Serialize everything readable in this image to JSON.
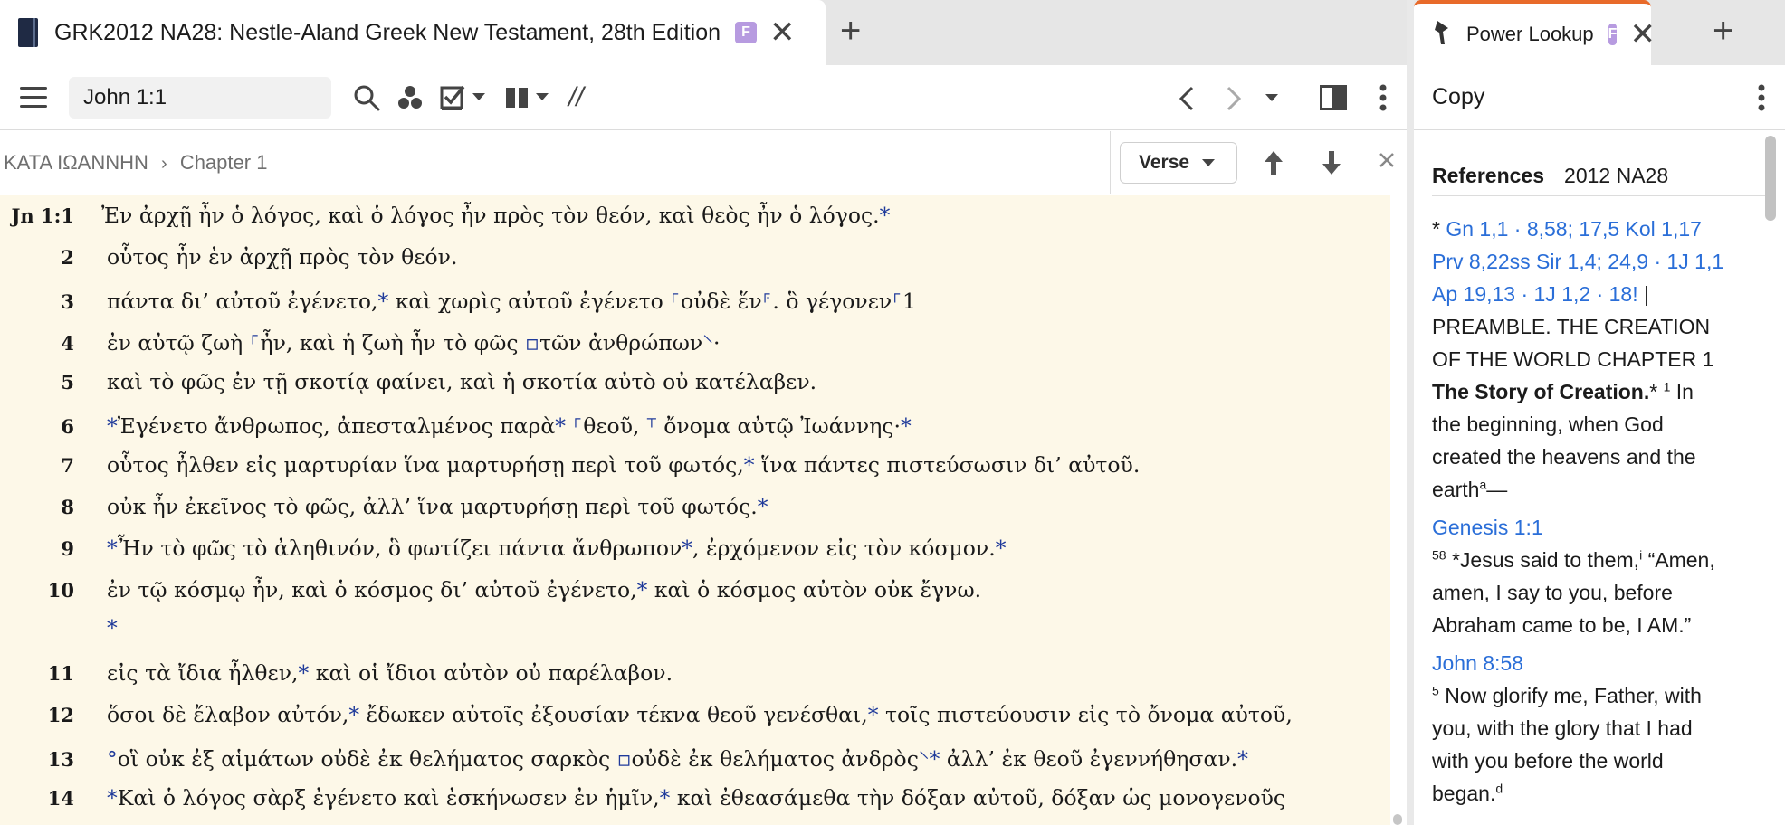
{
  "left_tab": {
    "title": "GRK2012 NA28: Nestle-Aland Greek New Testament, 28th Edition",
    "badge": "F",
    "close": "✕",
    "add": "+"
  },
  "toolbar": {
    "reference_value": "John 1:1",
    "parallel_label": "//"
  },
  "breadcrumb": {
    "book": "ΚΑΤΑ ΙΩΑΝΝΗΝ",
    "separator": "›",
    "chapter": "Chapter 1",
    "mode_select": "Verse"
  },
  "verses": [
    {
      "num": "Jn 1:1",
      "text": "Ἐν ἀρχῇ ἦν ὁ λόγος, καὶ ὁ λόγος ἦν πρὸς τὸν θεόν, καὶ θεὸς ἦν ὁ λόγος.*"
    },
    {
      "num": "2",
      "text": "οὗτος ἦν ἐν ἀρχῇ πρὸς τὸν θεόν."
    },
    {
      "num": "3",
      "text": "πάντα δι’ αὐτοῦ ἐγένετο,* καὶ χωρὶς αὐτοῦ ἐγένετο ⸀οὐδὲ ἕν⸁. ὃ γέγονεν⸀1"
    },
    {
      "num": "4",
      "text": "ἐν αὐτῷ ζωὴ ⸀ἦν, καὶ ἡ ζωὴ ἦν τὸ φῶς ▫τῶν ἀνθρώπων⸌·"
    },
    {
      "num": "5",
      "text": "καὶ τὸ φῶς ἐν τῇ σκοτίᾳ φαίνει, καὶ ἡ σκοτία αὐτὸ οὐ κατέλαβεν."
    },
    {
      "num": "6",
      "text": "*Ἐγένετο ἄνθρωπος, ἀπεσταλμένος παρὰ* ⸀θεοῦ, ⸆ ὄνομα αὐτῷ Ἰωάννης·*"
    },
    {
      "num": "7",
      "text": "οὗτος ἦλθεν εἰς μαρτυρίαν ἵνα μαρτυρήσῃ περὶ τοῦ φωτός,* ἵνα πάντες πιστεύσωσιν δι’ αὐτοῦ."
    },
    {
      "num": "8",
      "text": "οὐκ ἦν ἐκεῖνος τὸ φῶς, ἀλλ’ ἵνα μαρτυρήσῃ περὶ τοῦ φωτός.*"
    },
    {
      "num": "9",
      "text": "*Ἦν τὸ φῶς τὸ ἀληθινόν, ὃ φωτίζει πάντα ἄνθρωπον*, ἐρχόμενον εἰς τὸν κόσμον.*"
    },
    {
      "num": "10",
      "text": "ἐν τῷ κόσμῳ ἦν, καὶ ὁ κόσμος δι’ αὐτοῦ ἐγένετο,* καὶ ὁ κόσμος αὐτὸν οὐκ ἔγνω."
    },
    {
      "num": "",
      "text": "*"
    },
    {
      "num": "11",
      "text": "εἰς τὰ ἴδια ἦλθεν,* καὶ οἱ ἴδιοι αὐτὸν οὐ παρέλαβον."
    },
    {
      "num": "12",
      "text": "ὅσοι δὲ ἔλαβον αὐτόν,* ἔδωκεν αὐτοῖς ἐξουσίαν τέκνα θεοῦ γενέσθαι,* τοῖς πιστεύουσιν εἰς τὸ ὄνομα αὐτοῦ,"
    },
    {
      "num": "13",
      "text": "°οἳ οὐκ ἐξ αἱμάτων οὐδὲ ἐκ θελήματος σαρκὸς ▫οὐδὲ ἐκ θελήματος ἀνδρὸς⸌* ἀλλ’ ἐκ θεοῦ ἐγεννήθησαν.*"
    },
    {
      "num": "14",
      "text": "*Καὶ ὁ λόγος σὰρξ ἐγένετο καὶ ἐσκήνωσεν ἐν ἡμῖν,* καὶ ἐθεασάμεθα τὴν δόξαν αὐτοῦ, δόξαν ὡς μονογενοῦς"
    }
  ],
  "right_tab": {
    "title": "Power Lookup",
    "badge": "F",
    "close": "✕",
    "add": "+"
  },
  "lookup": {
    "copy_label": "Copy",
    "references_label": "References",
    "references_version": "2012 NA28",
    "cross_refs_line1": "Gn 1,1 · 8,58; 17,5 Kol 1,17",
    "cross_refs_line2": "Prv 8,22ss Sir 1,4; 24,9 · 1J 1,1",
    "cross_refs_line3": "Ap 19,13 · 1J 1,2 · 18!",
    "preamble_1": "PREAMBLE. THE CREATION",
    "preamble_2": "OF THE WORLD CHAPTER 1",
    "preamble_3": "The Story of Creation.",
    "gen_text_1": "In",
    "gen_text_2": "the beginning, when God",
    "gen_text_3": "created the heavens and the",
    "gen_text_4": "earth",
    "gen_ref": "Genesis 1:1",
    "john858_1": "*Jesus said to them,",
    "john858_1b": "“Amen,",
    "john858_2": "amen, I say to you, before",
    "john858_3": "Abraham came to be, I AM.”",
    "john858_ref": "John 8:58",
    "john175_1": "Now glorify me, Father, with",
    "john175_2": "you, with the glory that I had",
    "john175_3": "with you before the world",
    "john175_4": "began."
  }
}
